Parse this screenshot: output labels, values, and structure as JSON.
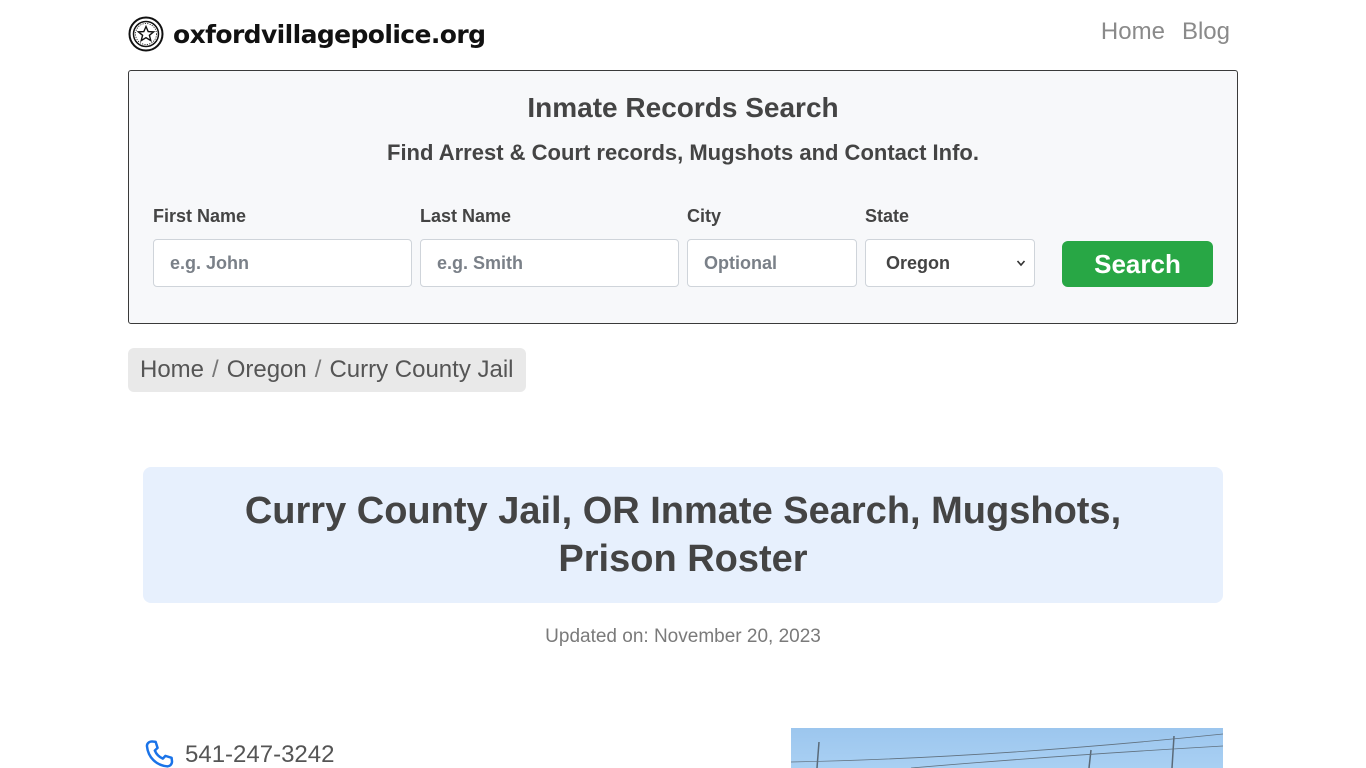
{
  "header": {
    "site_name": "oxfordvillagepolice.org",
    "logo_icon": "police-badge-star-icon",
    "nav": [
      {
        "label": "Home"
      },
      {
        "label": "Blog"
      }
    ]
  },
  "search": {
    "title": "Inmate Records Search",
    "subtitle": "Find Arrest & Court records, Mugshots and Contact Info.",
    "first_name": {
      "label": "First Name",
      "placeholder": "e.g. John",
      "value": ""
    },
    "last_name": {
      "label": "Last Name",
      "placeholder": "e.g. Smith",
      "value": ""
    },
    "city": {
      "label": "City",
      "placeholder": "Optional",
      "value": ""
    },
    "state": {
      "label": "State",
      "selected": "Oregon"
    },
    "button_label": "Search",
    "button_color": "#28a745"
  },
  "breadcrumb": {
    "items": [
      "Home",
      "Oregon",
      "Curry County Jail"
    ],
    "separator": "/"
  },
  "page": {
    "title": "Curry County Jail, OR Inmate Search, Mugshots, Prison Roster",
    "updated": "Updated on: November 20, 2023",
    "title_bg_color": "#e7f0fd"
  },
  "contact": {
    "phone": "541-247-3242",
    "phone_icon": "phone-icon"
  },
  "colors": {
    "accent_blue": "#1a73e8",
    "text": "#444444"
  }
}
